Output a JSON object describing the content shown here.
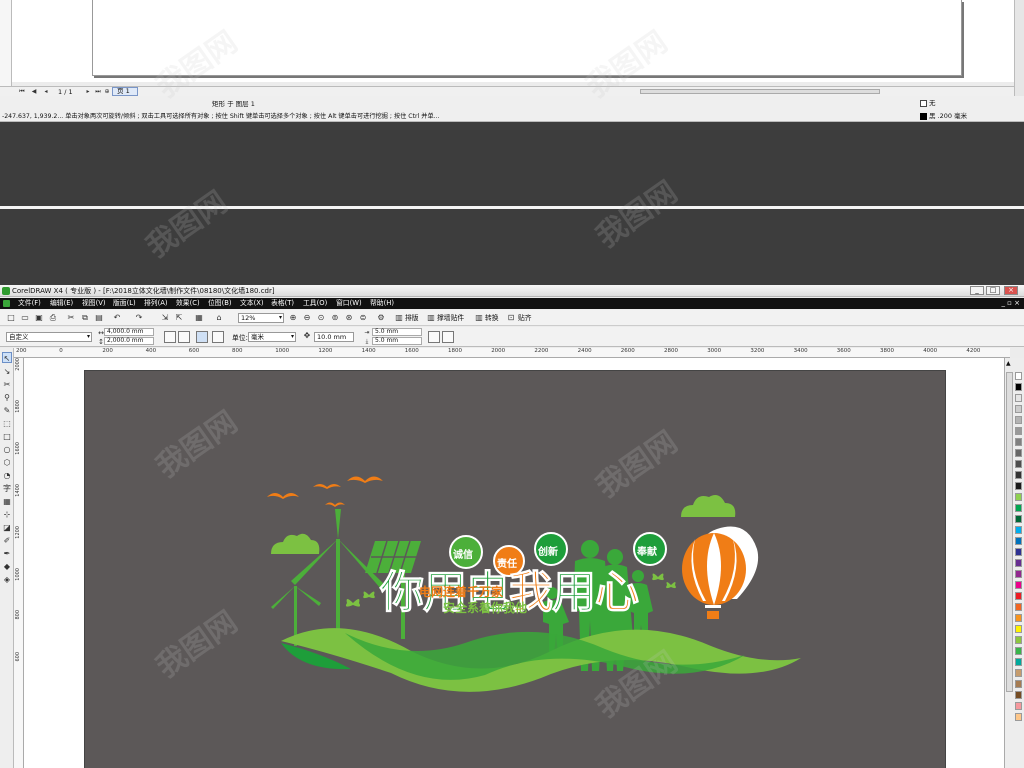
{
  "prev_window": {
    "page_counter": "1 / 1",
    "page_tab": "页 1",
    "status_layer": "矩形 于 图层 1",
    "status_hint": "-247.637, 1,939.2...   单击对象两次可旋转/倾斜 ; 双击工具可选择所有对象 ; 按住 Shift 键单击可选择多个对象 ; 按住 Alt 键单击可进行挖掘 ; 按住 Ctrl 并单...",
    "fill_label": "无",
    "outline_label": "黑 .200 毫米"
  },
  "window": {
    "title": "CorelDRAW X4 ( 专业版 ) - [F:\\2018立体文化墙\\制作文件\\08180\\文化墙180.cdr]",
    "menu": [
      "文件(F)",
      "编辑(E)",
      "视图(V)",
      "版面(L)",
      "排列(A)",
      "效果(C)",
      "位图(B)",
      "文本(X)",
      "表格(T)",
      "工具(O)",
      "窗口(W)",
      "帮助(H)"
    ],
    "toolbar": {
      "zoom": "12%",
      "typeset_label": "排版",
      "wrap_label": "撑墙贴件",
      "convert_label": "转换",
      "paste_label": "贴齐"
    },
    "property_bar": {
      "preset": "自定义",
      "width": "4,000.0 mm",
      "height": "2,000.0 mm",
      "units_label": "单位:",
      "units": "毫米",
      "nudge": "10.0 mm",
      "dup_x": "5.0 mm",
      "dup_y": "5.0 mm"
    },
    "ruler_h": [
      "200",
      "0",
      "200",
      "400",
      "600",
      "800",
      "1000",
      "1200",
      "1400",
      "1600",
      "1800",
      "2000",
      "2200",
      "2400",
      "2600",
      "2800",
      "3000",
      "3200",
      "3400",
      "3600",
      "3800",
      "4000",
      "4200"
    ],
    "ruler_v": [
      "2000",
      "1800",
      "1600",
      "1400",
      "1200",
      "1000",
      "800",
      "600"
    ]
  },
  "artwork": {
    "headline": [
      "你",
      "用",
      "电",
      "我",
      "用",
      "心"
    ],
    "badges": [
      "诚信",
      "责任",
      "创新",
      "奉献"
    ],
    "slogan1_a": "电网连着",
    "slogan1_b": "千万家",
    "slogan2_a": "安全系着",
    "slogan2_b": "你我他"
  },
  "colors": {
    "green_dark": "#1e9e3a",
    "green_light": "#7cc142",
    "orange": "#f07d16",
    "page_bg": "#5c5858"
  }
}
